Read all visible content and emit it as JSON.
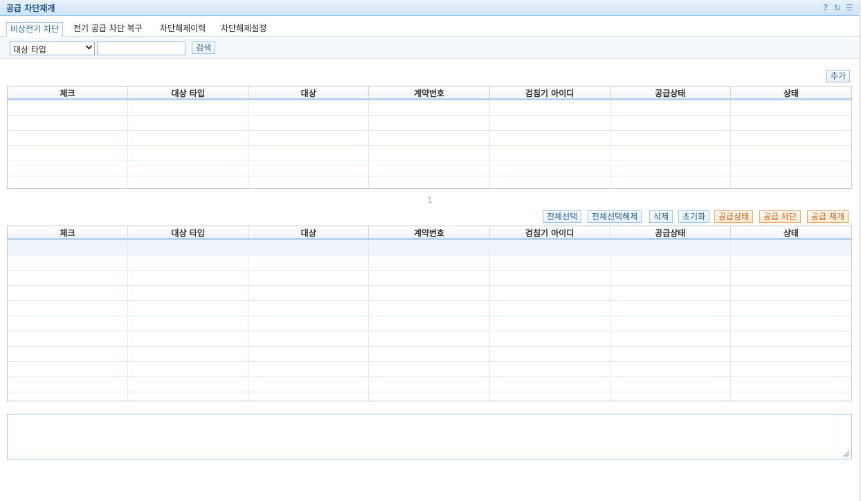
{
  "window": {
    "title": "공급 차단재개",
    "tools": [
      "help-icon",
      "refresh-icon",
      "menu-icon"
    ]
  },
  "tabs": [
    {
      "label": "비상전기 차단",
      "active": true
    },
    {
      "label": "전기 공급 차단 복구",
      "active": false
    },
    {
      "label": "차단해제이력",
      "active": false
    },
    {
      "label": "차단해제설정",
      "active": false
    }
  ],
  "search": {
    "type_selected": "대상 타입",
    "text_value": "",
    "button_label": "검색"
  },
  "top_table": {
    "add_label": "추가",
    "columns": [
      "체크",
      "대상 타입",
      "대상",
      "계약번호",
      "검침기 아이디",
      "공급상태",
      "상태"
    ],
    "rows": []
  },
  "pager": {
    "page": "1"
  },
  "bottom_table": {
    "actions": [
      {
        "label": "전체선택",
        "style": "blue"
      },
      {
        "label": "전체선택해제",
        "style": "blue"
      },
      {
        "label": "삭제",
        "style": "blue"
      },
      {
        "label": "초기화",
        "style": "blue"
      },
      {
        "label": "공급상태",
        "style": "orange"
      },
      {
        "label": "공급 차단",
        "style": "orange"
      },
      {
        "label": "공급 재개",
        "style": "orange"
      }
    ],
    "columns": [
      "체크",
      "대상 타입",
      "대상",
      "계약번호",
      "검침기 아이디",
      "공급상태",
      "상태"
    ],
    "rows": []
  },
  "memo": {
    "value": ""
  },
  "colors": {
    "accent": "#1f4f8a",
    "orange": "#c6661b",
    "border": "#a9c7e6"
  }
}
